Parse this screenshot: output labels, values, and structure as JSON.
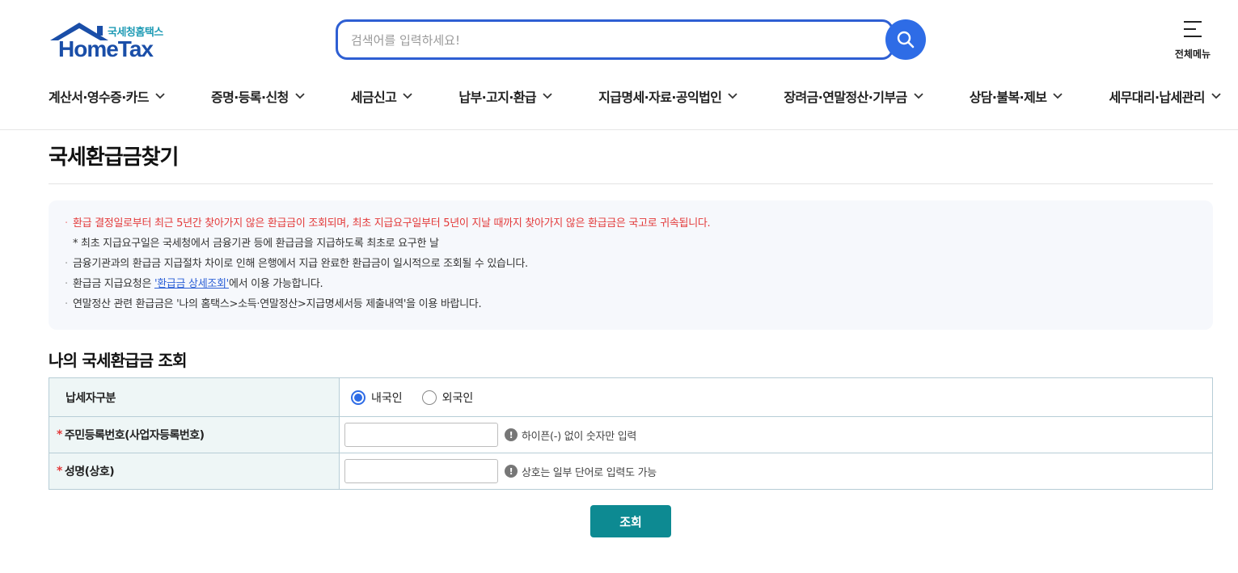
{
  "header": {
    "logo_sub": "국세청홈택스",
    "logo_main": "HomeTax",
    "search_placeholder": "검색어를 입력하세요!",
    "all_menu_label": "전체메뉴"
  },
  "gnb": [
    {
      "label": "계산서·영수증·카드"
    },
    {
      "label": "증명·등록·신청"
    },
    {
      "label": "세금신고"
    },
    {
      "label": "납부·고지·환급"
    },
    {
      "label": "지급명세·자료·공익법인"
    },
    {
      "label": "장려금·연말정산·기부금"
    },
    {
      "label": "상담·불복·제보"
    },
    {
      "label": "세무대리·납세관리"
    }
  ],
  "page": {
    "title": "국세환급금찾기"
  },
  "notice": {
    "line1": "환급 결정일로부터 최근 5년간 찾아가지 않은 환급금이 조회되며, 최초 지급요구일부터 5년이 지날 때까지 찾아가지 않은 환급금은 국고로 귀속됩니다.",
    "line1_sub": "* 최초 지급요구일은 국세청에서 금융기관 등에 환급금을 지급하도록 최초로 요구한 날",
    "line2": "금융기관과의 환급금 지급절차 차이로 인해 은행에서 지급 완료한 환급금이 일시적으로 조회될 수 있습니다.",
    "line3_pre": "환급금 지급요청은 ",
    "line3_link": "'환급금 상세조회'",
    "line3_post": "에서 이용 가능합니다.",
    "line4": "연말정산 관련 환급금은 '나의 홈택스>소득·연말정산>지급명세서등 제출내역'을 이용 바랍니다."
  },
  "section": {
    "title": "나의 국세환급금 조회"
  },
  "form": {
    "taxpayer_type_label": "납세자구분",
    "radio_domestic": "내국인",
    "radio_foreign": "외국인",
    "selected": "내국인",
    "required_mark": "*",
    "id_label": "주민등록번호(사업자등록번호)",
    "id_value": "",
    "id_hint": "하이픈(-) 없이 숫자만 입력",
    "name_label": "성명(상호)",
    "name_value": "",
    "name_hint": "상호는 일부 단어로 입력도 가능",
    "hint_icon_glyph": "!",
    "submit_label": "조회"
  },
  "colors": {
    "brand_blue": "#1a4ea8",
    "search_blue": "#2e6ce6",
    "notice_red": "#e33a3a",
    "submit_teal": "#0d8a92"
  }
}
